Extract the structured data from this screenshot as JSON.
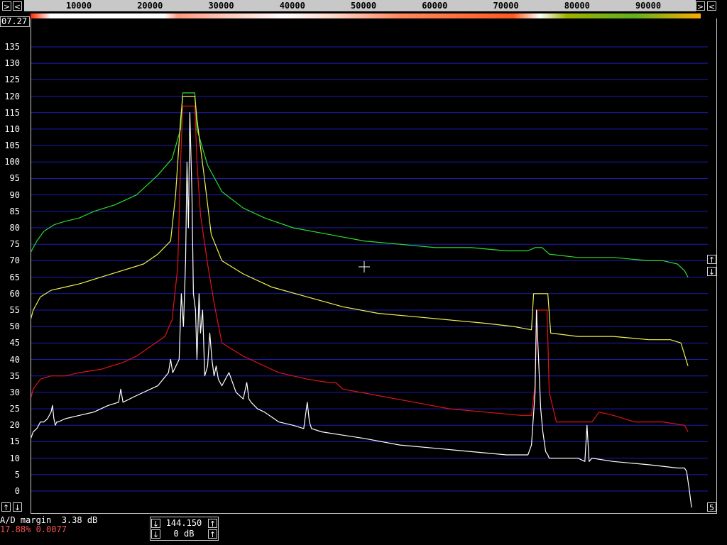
{
  "frequency_scale": {
    "ticks": [
      "10000",
      "20000",
      "30000",
      "40000",
      "50000",
      "60000",
      "70000",
      "80000",
      "90000"
    ],
    "tick_values": [
      10000,
      20000,
      30000,
      40000,
      50000,
      60000,
      70000,
      80000,
      90000
    ],
    "min_hz": 2500,
    "max_hz": 96700,
    "scroll_left_label": "<",
    "scroll_right_label": ">",
    "scroll_end_label": "<"
  },
  "time_readout": "07.27",
  "y_axis": {
    "labels": [
      "135",
      "130",
      "125",
      "120",
      "115",
      "110",
      "105",
      "100",
      "95",
      "90",
      "85",
      "80",
      "75",
      "70",
      "65",
      "60",
      "55",
      "50",
      "45",
      "40",
      "35",
      "30",
      "25",
      "20",
      "15",
      "10",
      "5",
      "0"
    ],
    "ylim": [
      -5,
      137.5
    ]
  },
  "controls": {
    "zoom_up_label": "↑",
    "zoom_down_label": "↓",
    "right_up_label": "↑",
    "right_down_label": "↓",
    "right_bottom_label": "5",
    "freq_value": "144.150",
    "gain_value": "0 dB",
    "freq_down_label": "↓",
    "freq_up_label": "↑",
    "gain_down_label": "↓",
    "gain_up_label": "↑"
  },
  "status": {
    "ad_margin": "A/D margin  3.38 dB",
    "rel_level": "17.88% 0.0077"
  },
  "colors": {
    "grid": "#1c1cb4",
    "green_trace": "#2ddc2d",
    "yellow_trace": "#f0f050",
    "red_trace": "#e11414",
    "white_trace": "#ffffff"
  },
  "chart_data": {
    "type": "line",
    "xlabel": "",
    "ylabel": "",
    "xlim": [
      2500,
      96700
    ],
    "ylim": [
      -5,
      137.5
    ],
    "grid": true,
    "series": [
      {
        "color": "#2ddc2d",
        "x": [
          3000,
          4000,
          5000,
          6500,
          8000,
          10000,
          12000,
          15000,
          18000,
          21000,
          23000,
          24200,
          24500,
          26200,
          26500,
          28000,
          30000,
          33000,
          36000,
          40000,
          45000,
          50000,
          55000,
          60000,
          65000,
          70000,
          73000,
          74000,
          75000,
          76000,
          80000,
          85000,
          90000,
          92000,
          94000,
          95000,
          95500
        ],
        "y": [
          72,
          76,
          79,
          81,
          82,
          83,
          85,
          87,
          90,
          96,
          101,
          110,
          121,
          121,
          110,
          99,
          91,
          86,
          83,
          80,
          78,
          76,
          75,
          74,
          74,
          73,
          73,
          74,
          74,
          72,
          71,
          71,
          70,
          70,
          69,
          67,
          65
        ]
      },
      {
        "color": "#f0f050",
        "x": [
          3000,
          3500,
          4500,
          6000,
          8000,
          10000,
          13000,
          16000,
          19000,
          21000,
          22800,
          23500,
          24200,
          24500,
          26200,
          26500,
          27500,
          28500,
          30000,
          33000,
          37000,
          42000,
          47000,
          52000,
          57000,
          62000,
          67000,
          71000,
          73500,
          73800,
          75800,
          76200,
          80000,
          85000,
          90000,
          93000,
          94500,
          95500
        ],
        "y": [
          51,
          55,
          59,
          61,
          62,
          63,
          65,
          67,
          69,
          72,
          76,
          90,
          113,
          120,
          120,
          113,
          96,
          78,
          70,
          66,
          62,
          59,
          56,
          54,
          53,
          52,
          51,
          50,
          49,
          60,
          60,
          48,
          47,
          47,
          46,
          46,
          45,
          38
        ]
      },
      {
        "color": "#e11414",
        "x": [
          3000,
          3500,
          4500,
          6000,
          8000,
          10000,
          13000,
          16000,
          18000,
          20000,
          22000,
          23000,
          23800,
          24200,
          24500,
          26200,
          26500,
          27000,
          28000,
          29000,
          30000,
          33000,
          38000,
          42000,
          45000,
          46000,
          47000,
          52000,
          57000,
          62000,
          67000,
          72000,
          73500,
          74000,
          74300,
          75700,
          76000,
          77000,
          80000,
          82000,
          83000,
          85000,
          88000,
          92000,
          95000,
          95500
        ],
        "y": [
          27,
          31,
          34,
          35,
          35,
          36,
          37,
          39,
          41,
          44,
          47,
          52,
          68,
          100,
          117,
          117,
          100,
          84,
          69,
          56,
          45,
          41,
          36,
          34,
          33,
          33,
          31,
          29,
          27,
          25,
          24,
          23,
          23,
          32,
          55,
          55,
          30,
          21,
          21,
          21,
          24,
          23,
          21,
          21,
          20,
          18
        ]
      },
      {
        "color": "#ffffff",
        "x": [
          2500,
          2700,
          3000,
          3500,
          4000,
          4500,
          5000,
          5500,
          6000,
          6200,
          6400,
          6600,
          6800,
          7000,
          8000,
          10000,
          12000,
          14000,
          15500,
          15800,
          16100,
          18000,
          21000,
          22500,
          22800,
          23100,
          24000,
          24300,
          24600,
          24900,
          25100,
          25300,
          25500,
          25800,
          26000,
          26300,
          26500,
          26800,
          27000,
          27300,
          27600,
          28000,
          28300,
          28600,
          28900,
          29200,
          29500,
          30000,
          30500,
          31000,
          32000,
          33000,
          33500,
          33800,
          34100,
          35000,
          36000,
          38000,
          40000,
          41500,
          42000,
          42300,
          42600,
          44000,
          47000,
          50000,
          55000,
          60000,
          65000,
          70000,
          73000,
          73500,
          74000,
          74200,
          74500,
          74800,
          75100,
          75500,
          75800,
          76000,
          77000,
          80000,
          81000,
          81300,
          81600,
          82000,
          85000,
          90000,
          94000,
          95000,
          95300,
          95700,
          96000
        ],
        "y": [
          -4,
          5,
          15,
          18,
          19,
          21,
          21,
          22,
          24,
          26,
          22,
          20,
          21,
          21,
          22,
          23,
          24,
          26,
          27,
          31,
          27,
          29,
          32,
          36,
          40,
          36,
          40,
          60,
          50,
          70,
          100,
          80,
          115,
          90,
          60,
          55,
          40,
          60,
          48,
          55,
          35,
          38,
          48,
          40,
          35,
          38,
          34,
          32,
          34,
          36,
          30,
          28,
          33,
          28,
          27,
          25,
          24,
          21,
          20,
          19,
          27,
          21,
          19,
          18,
          17,
          16,
          14,
          13,
          12,
          11,
          11,
          14,
          30,
          55,
          40,
          25,
          18,
          12,
          11,
          10,
          10,
          10,
          9,
          20,
          9,
          10,
          9,
          8,
          7,
          7,
          6,
          0,
          -5
        ]
      }
    ]
  }
}
